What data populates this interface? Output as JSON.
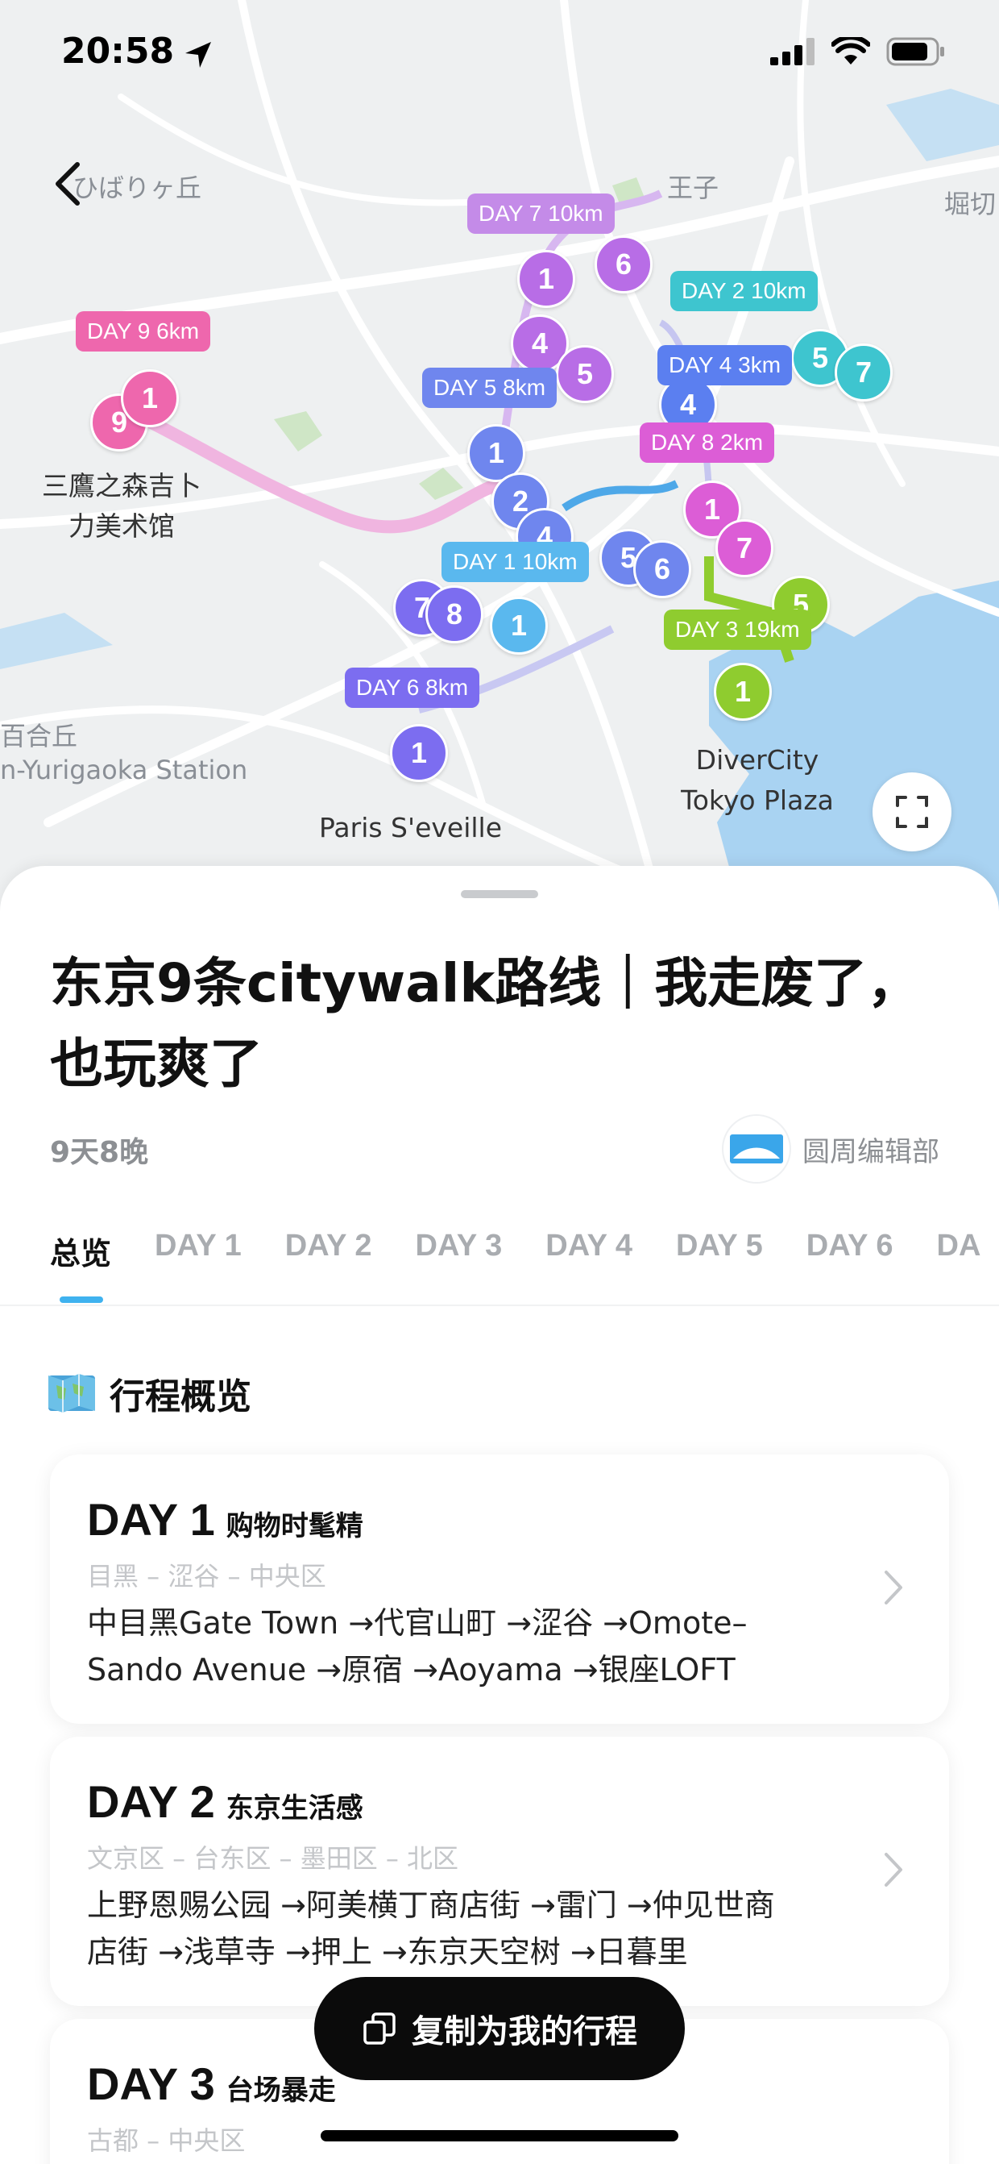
{
  "status_bar": {
    "time": "20:58"
  },
  "map": {
    "places": {
      "hibarigaoka": "ひばりヶ丘",
      "oji": "王子",
      "horikiri": "堀切",
      "ghibli": "三鷹之森吉卜力美术馆",
      "yurigaoka_jp": "百合丘",
      "yurigaoka_en": "n-Yurigaoka Station",
      "paris": "Paris S'eveille",
      "divercity": "DiverCity Tokyo Plaza"
    },
    "day_tags": {
      "d7": "DAY 7 10km",
      "d2": "DAY 2 10km",
      "d9": "DAY 9 6km",
      "d4": "DAY 4 3km",
      "d5": "DAY 5 8km",
      "d8": "DAY 8 2km",
      "d1": "DAY 1 10km",
      "d3": "DAY 3 19km",
      "d6": "DAY 6 8km"
    },
    "colors": {
      "day1": "#5ab8ee",
      "day2": "#3ec5cf",
      "day3": "#8fcc2f",
      "day4": "#5b7ff0",
      "day5": "#6f86ee",
      "day6": "#7c6df0",
      "day7": "#b86de6",
      "day8": "#dc5dd6",
      "day9": "#ee67ad"
    }
  },
  "trip": {
    "title": "东京9条citywalk路线｜我走废了，也玩爽了",
    "duration": "9天8晚",
    "author": "圆周编辑部"
  },
  "tabs": [
    "总览",
    "DAY 1",
    "DAY 2",
    "DAY 3",
    "DAY 4",
    "DAY 5",
    "DAY 6",
    "DA"
  ],
  "overview": {
    "heading": "行程概览",
    "days": [
      {
        "label": "DAY 1",
        "theme": "购物时髦精",
        "area": "目黑 – 涩谷 – 中央区",
        "route_line1": "中目黑Gate Town →代官山町 →涩谷 →Omote–",
        "route_line2": "Sando Avenue →原宿 →Aoyama →银座LOFT"
      },
      {
        "label": "DAY 2",
        "theme": "东京生活感",
        "area": "文京区 – 台东区 – 墨田区 – 北区",
        "route_line1": "上野恩赐公园 →阿美横丁商店街 →雷门 →仲见世商",
        "route_line2": "店街 →浅草寺 →押上 →东京天空树 →日暮里"
      },
      {
        "label": "DAY 3",
        "theme": "台场暴走",
        "area": "古都 – 中央区"
      }
    ]
  },
  "copy_button": {
    "label": "复制为我的行程"
  }
}
